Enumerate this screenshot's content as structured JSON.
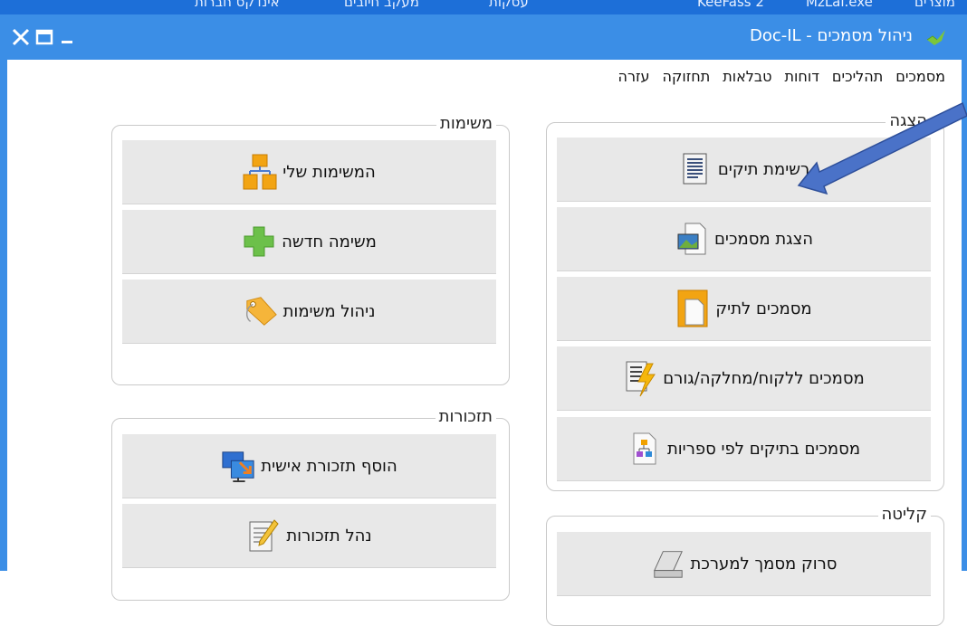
{
  "top_strip": {
    "items": [
      "אינדקס חברות",
      "מעקב חיובים",
      "עסקות",
      "KeeFass 2",
      "MzLal.exe",
      "מוצרים"
    ]
  },
  "window": {
    "title": "ניהול מסמכים - Doc-IL",
    "controls": {
      "close": "✕",
      "maximize": "☐",
      "minimize": "_"
    }
  },
  "menu": [
    "מסמכים",
    "תהליכים",
    "דוחות",
    "טבלאות",
    "תחזוקה",
    "עזרה"
  ],
  "groups": {
    "display": {
      "label": "הצגה",
      "buttons": [
        {
          "label": "רשימת תיקים",
          "icon": "file-list-icon"
        },
        {
          "label": "הצגת מסמכים",
          "icon": "document-image-icon"
        },
        {
          "label": "מסמכים לתיק",
          "icon": "folder-document-icon"
        },
        {
          "label": "מסמכים ללקוח/מחלקה/גורם",
          "icon": "lightning-document-icon"
        },
        {
          "label": "מסמכים בתיקים לפי ספריות",
          "icon": "org-chart-document-icon"
        }
      ]
    },
    "tasks": {
      "label": "משימות",
      "buttons": [
        {
          "label": "המשימות שלי",
          "icon": "folder-tree-icon"
        },
        {
          "label": "משימה חדשה",
          "icon": "plus-icon"
        },
        {
          "label": "ניהול משימות",
          "icon": "tag-icon"
        }
      ]
    },
    "reminders": {
      "label": "תזכורות",
      "buttons": [
        {
          "label": "הוסף תזכורת אישית",
          "icon": "monitor-add-icon"
        },
        {
          "label": "נהל תזכורות",
          "icon": "notepad-pencil-icon"
        }
      ]
    },
    "intake": {
      "label": "קליטה",
      "buttons": [
        {
          "label": "סרוק מסמך למערכת",
          "icon": "scanner-icon"
        }
      ]
    }
  },
  "colors": {
    "titlebar": "#3b8ee6",
    "button_bg": "#e8e8e8",
    "arrow": "#3a5db8"
  }
}
